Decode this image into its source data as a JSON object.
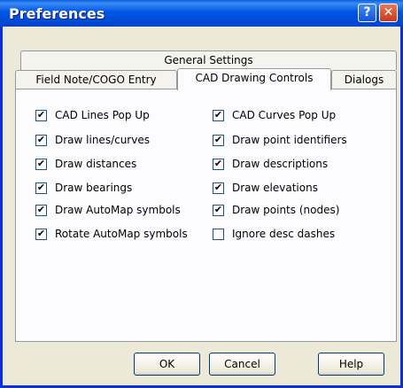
{
  "window": {
    "title": "Preferences"
  },
  "title_buttons": {
    "help": "?",
    "close": "✕"
  },
  "tabs": {
    "row1": [
      "General Settings"
    ],
    "row2": [
      "Field Note/COGO Entry",
      "CAD Drawing Controls",
      "Dialogs"
    ],
    "active": "CAD Drawing Controls"
  },
  "options_left": [
    {
      "label": "CAD Lines Pop Up",
      "checked": true
    },
    {
      "label": "Draw lines/curves",
      "checked": true
    },
    {
      "label": "Draw distances",
      "checked": true
    },
    {
      "label": "Draw bearings",
      "checked": true
    },
    {
      "label": "Draw AutoMap symbols",
      "checked": true
    },
    {
      "label": "Rotate AutoMap symbols",
      "checked": true
    }
  ],
  "options_right": [
    {
      "label": "CAD Curves Pop Up",
      "checked": true
    },
    {
      "label": "Draw point identifiers",
      "checked": true
    },
    {
      "label": "Draw descriptions",
      "checked": true
    },
    {
      "label": "Draw elevations",
      "checked": true
    },
    {
      "label": "Draw points (nodes)",
      "checked": true
    },
    {
      "label": "Ignore desc dashes",
      "checked": false
    }
  ],
  "buttons": {
    "ok": "OK",
    "cancel": "Cancel",
    "help": "Help"
  },
  "check_glyph": "✔"
}
